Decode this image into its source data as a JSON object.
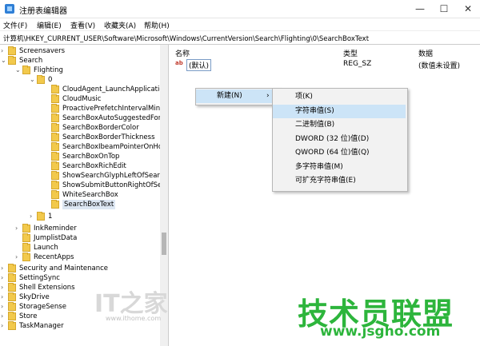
{
  "window": {
    "title": "注册表编辑器",
    "minimize": "—",
    "maximize": "☐",
    "close": "✕"
  },
  "menu": [
    "文件(F)",
    "编辑(E)",
    "查看(V)",
    "收藏夹(A)",
    "帮助(H)"
  ],
  "address": "计算机\\HKEY_CURRENT_USER\\Software\\Microsoft\\Windows\\CurrentVersion\\Search\\Flighting\\0\\SearchBoxText",
  "tree": [
    {
      "label": "Screensavers",
      "toggle": "›"
    },
    {
      "label": "Search",
      "toggle": "⌄"
    },
    {
      "label": "Flighting",
      "toggle": "⌄"
    },
    {
      "label": "0",
      "toggle": "⌄"
    },
    {
      "label": "CloudAgent_LaunchApplication",
      "toggle": ""
    },
    {
      "label": "CloudMusic",
      "toggle": ""
    },
    {
      "label": "ProactivePrefetchIntervalMinute",
      "toggle": ""
    },
    {
      "label": "SearchBoxAutoSuggestedFore",
      "toggle": ""
    },
    {
      "label": "SearchBoxBorderColor",
      "toggle": ""
    },
    {
      "label": "SearchBoxBorderThickness",
      "toggle": ""
    },
    {
      "label": "SearchBoxIbeamPointerOnHov",
      "toggle": ""
    },
    {
      "label": "SearchBoxOnTop",
      "toggle": ""
    },
    {
      "label": "SearchBoxRichEdit",
      "toggle": ""
    },
    {
      "label": "ShowSearchGlyphLeftOfSearch",
      "toggle": ""
    },
    {
      "label": "ShowSubmitButtonRightOfSear",
      "toggle": ""
    },
    {
      "label": "WhiteSearchBox",
      "toggle": ""
    },
    {
      "label": "SearchBoxText",
      "toggle": ""
    },
    {
      "label": "1",
      "toggle": "›"
    },
    {
      "label": "InkReminder",
      "toggle": "›"
    },
    {
      "label": "JumplistData",
      "toggle": ""
    },
    {
      "label": "Launch",
      "toggle": ""
    },
    {
      "label": "RecentApps",
      "toggle": "›"
    },
    {
      "label": "Security and Maintenance",
      "toggle": "›"
    },
    {
      "label": "SettingSync",
      "toggle": "›"
    },
    {
      "label": "Shell Extensions",
      "toggle": "›"
    },
    {
      "label": "SkyDrive",
      "toggle": "›"
    },
    {
      "label": "StorageSense",
      "toggle": "›"
    },
    {
      "label": "Store",
      "toggle": "›"
    },
    {
      "label": "TaskManager",
      "toggle": "›"
    }
  ],
  "columns": {
    "name": "名称",
    "type": "类型",
    "data": "数据"
  },
  "value_row": {
    "icon": "ab",
    "name": "(默认)",
    "type": "REG_SZ",
    "data": "(数值未设置)"
  },
  "context_menu": {
    "new_label": "新建(N)",
    "arrow": "›"
  },
  "submenu": [
    "项(K)",
    "字符串值(S)",
    "二进制值(B)",
    "DWORD (32 位)值(D)",
    "QWORD (64 位)值(Q)",
    "多字符串值(M)",
    "可扩充字符串值(E)"
  ],
  "watermarks": {
    "ithome": "IT之家",
    "ithome_url": "www.ithome.com",
    "jsgho": "技术员联盟",
    "jsgho_url": "www.jsgho.com"
  },
  "colors": {
    "selection": "#cce4f7",
    "folder": "#f2c94c",
    "watermark_green": "#2db53c"
  }
}
